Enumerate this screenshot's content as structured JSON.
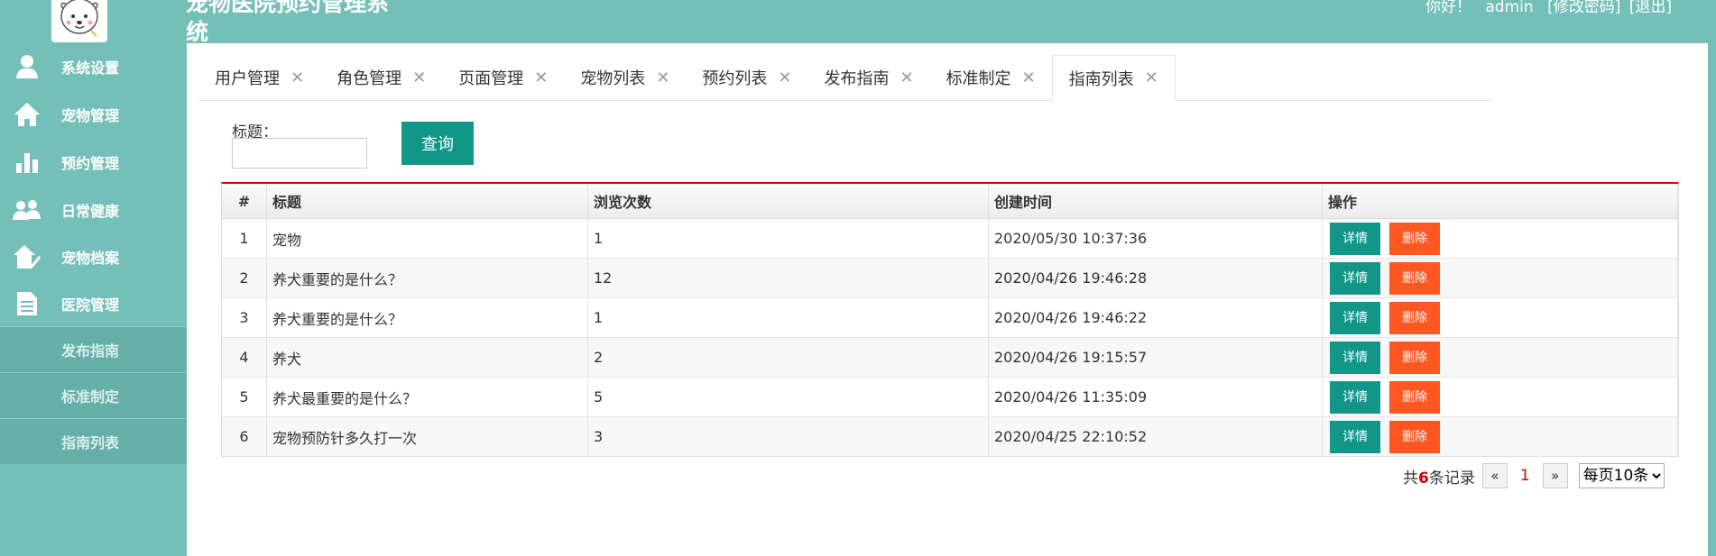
{
  "header": {
    "title": "宠物医院预约管理系统",
    "greeting": "你好！",
    "username": "admin",
    "change_password": "[修改密码]",
    "logout": "[退出]"
  },
  "sidebar": {
    "items": [
      {
        "label": "系统设置",
        "icon": "user-icon"
      },
      {
        "label": "宠物管理",
        "icon": "home-icon"
      },
      {
        "label": "预约管理",
        "icon": "bar-chart-icon"
      },
      {
        "label": "日常健康",
        "icon": "group-icon"
      },
      {
        "label": "宠物档案",
        "icon": "home-check-icon"
      },
      {
        "label": "医院管理",
        "icon": "document-icon"
      }
    ],
    "subitems": [
      {
        "label": "发布指南"
      },
      {
        "label": "标准制定"
      },
      {
        "label": "指南列表"
      }
    ]
  },
  "tabs": [
    {
      "label": "用户管理"
    },
    {
      "label": "角色管理"
    },
    {
      "label": "页面管理"
    },
    {
      "label": "宠物列表"
    },
    {
      "label": "预约列表"
    },
    {
      "label": "发布指南"
    },
    {
      "label": "标准制定"
    },
    {
      "label": "指南列表",
      "active": true
    }
  ],
  "tab_close_glyph": "✕",
  "search": {
    "label": "标题：",
    "value": "",
    "button": "查询"
  },
  "table": {
    "headers": [
      "#",
      "标题",
      "浏览次数",
      "创建时间",
      "操作"
    ],
    "rows": [
      {
        "num": "1",
        "title": "宠物",
        "views": "1",
        "created": "2020/05/30 10:37:36"
      },
      {
        "num": "2",
        "title": "养犬重要的是什么？",
        "views": "12",
        "created": "2020/04/26 19:46:28"
      },
      {
        "num": "3",
        "title": "养犬重要的是什么？",
        "views": "1",
        "created": "2020/04/26 19:46:22"
      },
      {
        "num": "4",
        "title": "养犬",
        "views": "2",
        "created": "2020/04/26 19:15:57"
      },
      {
        "num": "5",
        "title": "养犬最重要的是什么？",
        "views": "5",
        "created": "2020/04/26 11:35:09"
      },
      {
        "num": "6",
        "title": "宠物预防针多久打一次",
        "views": "3",
        "created": "2020/04/25 22:10:52"
      }
    ],
    "detail_label": "详情",
    "delete_label": "删除"
  },
  "pagination": {
    "total_prefix": "共",
    "total": "6",
    "total_suffix": "条记录",
    "prev": "«",
    "current": "1",
    "next": "»",
    "page_size": "每页10条"
  },
  "colors": {
    "primary": "#74c0b9",
    "button_teal": "#119688",
    "button_orange": "#ff5722",
    "table_accent": "#b4161b"
  }
}
